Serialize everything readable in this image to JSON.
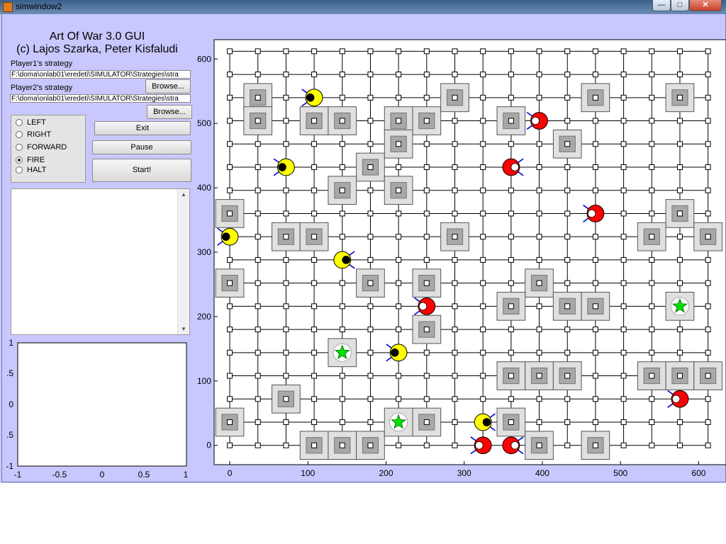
{
  "window": {
    "title": "simwindow2",
    "controls": [
      "—",
      "□",
      "✕"
    ]
  },
  "header": {
    "app_name": "Art Of War 3.0 GUI",
    "credits": "(c) Lajos Szarka, Peter Kisfaludi"
  },
  "player1": {
    "label": "Player1's strategy",
    "path": "F:\\doma\\onlab01\\eredeti\\SIMULATOR\\Strategies\\stra",
    "browse_label": "Browse..."
  },
  "player2": {
    "label": "Player2's strategy",
    "path": "F:\\doma\\onlab01\\eredeti\\SIMULATOR\\Strategies\\stra",
    "browse_label": "Browse..."
  },
  "actions": {
    "options": [
      "LEFT",
      "RIGHT",
      "FORWARD",
      "FIRE",
      "HALT"
    ],
    "selected": "FIRE"
  },
  "buttons": {
    "exit": "Exit",
    "pause": "Pause",
    "start": "Start!"
  },
  "log_list": {
    "items": []
  },
  "small_axes": {
    "y_ticks": [
      "1",
      ".5",
      "0",
      ".5",
      "-1"
    ],
    "x_ticks": [
      "-1",
      "-0.5",
      "0",
      "0.5",
      "1"
    ]
  },
  "board": {
    "x_ticks": [
      0,
      100,
      200,
      300,
      400,
      500,
      600
    ],
    "y_ticks": [
      0,
      100,
      200,
      300,
      400,
      500,
      600
    ],
    "xlim": [
      -20,
      635
    ],
    "ylim": [
      -30,
      630
    ],
    "grid_step": 36,
    "grid_count": 18,
    "colors": {
      "background": "#ffffff",
      "grid": "#000000",
      "wall_outer": "#e0e0e0",
      "wall_inner": "#a8a8a8",
      "player1": "#ffff00",
      "player2": "#ff0000",
      "goal_star": "#00e000",
      "barrel": "#0000cc"
    },
    "walls": [
      [
        1,
        15
      ],
      [
        1,
        14
      ],
      [
        3,
        14
      ],
      [
        4,
        14
      ],
      [
        6,
        14
      ],
      [
        7,
        14
      ],
      [
        8,
        15
      ],
      [
        10,
        14
      ],
      [
        13,
        15
      ],
      [
        16,
        15
      ],
      [
        5,
        12
      ],
      [
        6,
        13
      ],
      [
        12,
        13
      ],
      [
        4,
        11
      ],
      [
        6,
        11
      ],
      [
        0,
        10
      ],
      [
        16,
        10
      ],
      [
        2,
        9
      ],
      [
        3,
        9
      ],
      [
        8,
        9
      ],
      [
        15,
        9
      ],
      [
        17,
        9
      ],
      [
        0,
        7
      ],
      [
        5,
        7
      ],
      [
        7,
        7
      ],
      [
        11,
        7
      ],
      [
        10,
        6
      ],
      [
        12,
        6
      ],
      [
        13,
        6
      ],
      [
        7,
        5
      ],
      [
        10,
        3
      ],
      [
        11,
        3
      ],
      [
        12,
        3
      ],
      [
        15,
        3
      ],
      [
        16,
        3
      ],
      [
        17,
        3
      ],
      [
        2,
        2
      ],
      [
        0,
        1
      ],
      [
        7,
        1
      ],
      [
        10,
        1
      ],
      [
        3,
        0
      ],
      [
        4,
        0
      ],
      [
        5,
        0
      ],
      [
        11,
        0
      ],
      [
        13,
        0
      ]
    ],
    "goals": [
      [
        16,
        6
      ],
      [
        4,
        4
      ],
      [
        6,
        1
      ]
    ],
    "player1_units": [
      [
        3,
        15,
        "left"
      ],
      [
        2,
        12,
        "left"
      ],
      [
        0,
        9,
        "left"
      ],
      [
        4,
        8,
        "right"
      ],
      [
        6,
        4,
        "left"
      ],
      [
        9,
        1,
        "right"
      ]
    ],
    "player2_units": [
      [
        11,
        14,
        "left"
      ],
      [
        10,
        12,
        "right"
      ],
      [
        13,
        10,
        "left"
      ],
      [
        7,
        6,
        "left"
      ],
      [
        16,
        2,
        "left"
      ],
      [
        9,
        0,
        "left"
      ],
      [
        10,
        0,
        "right"
      ]
    ]
  }
}
